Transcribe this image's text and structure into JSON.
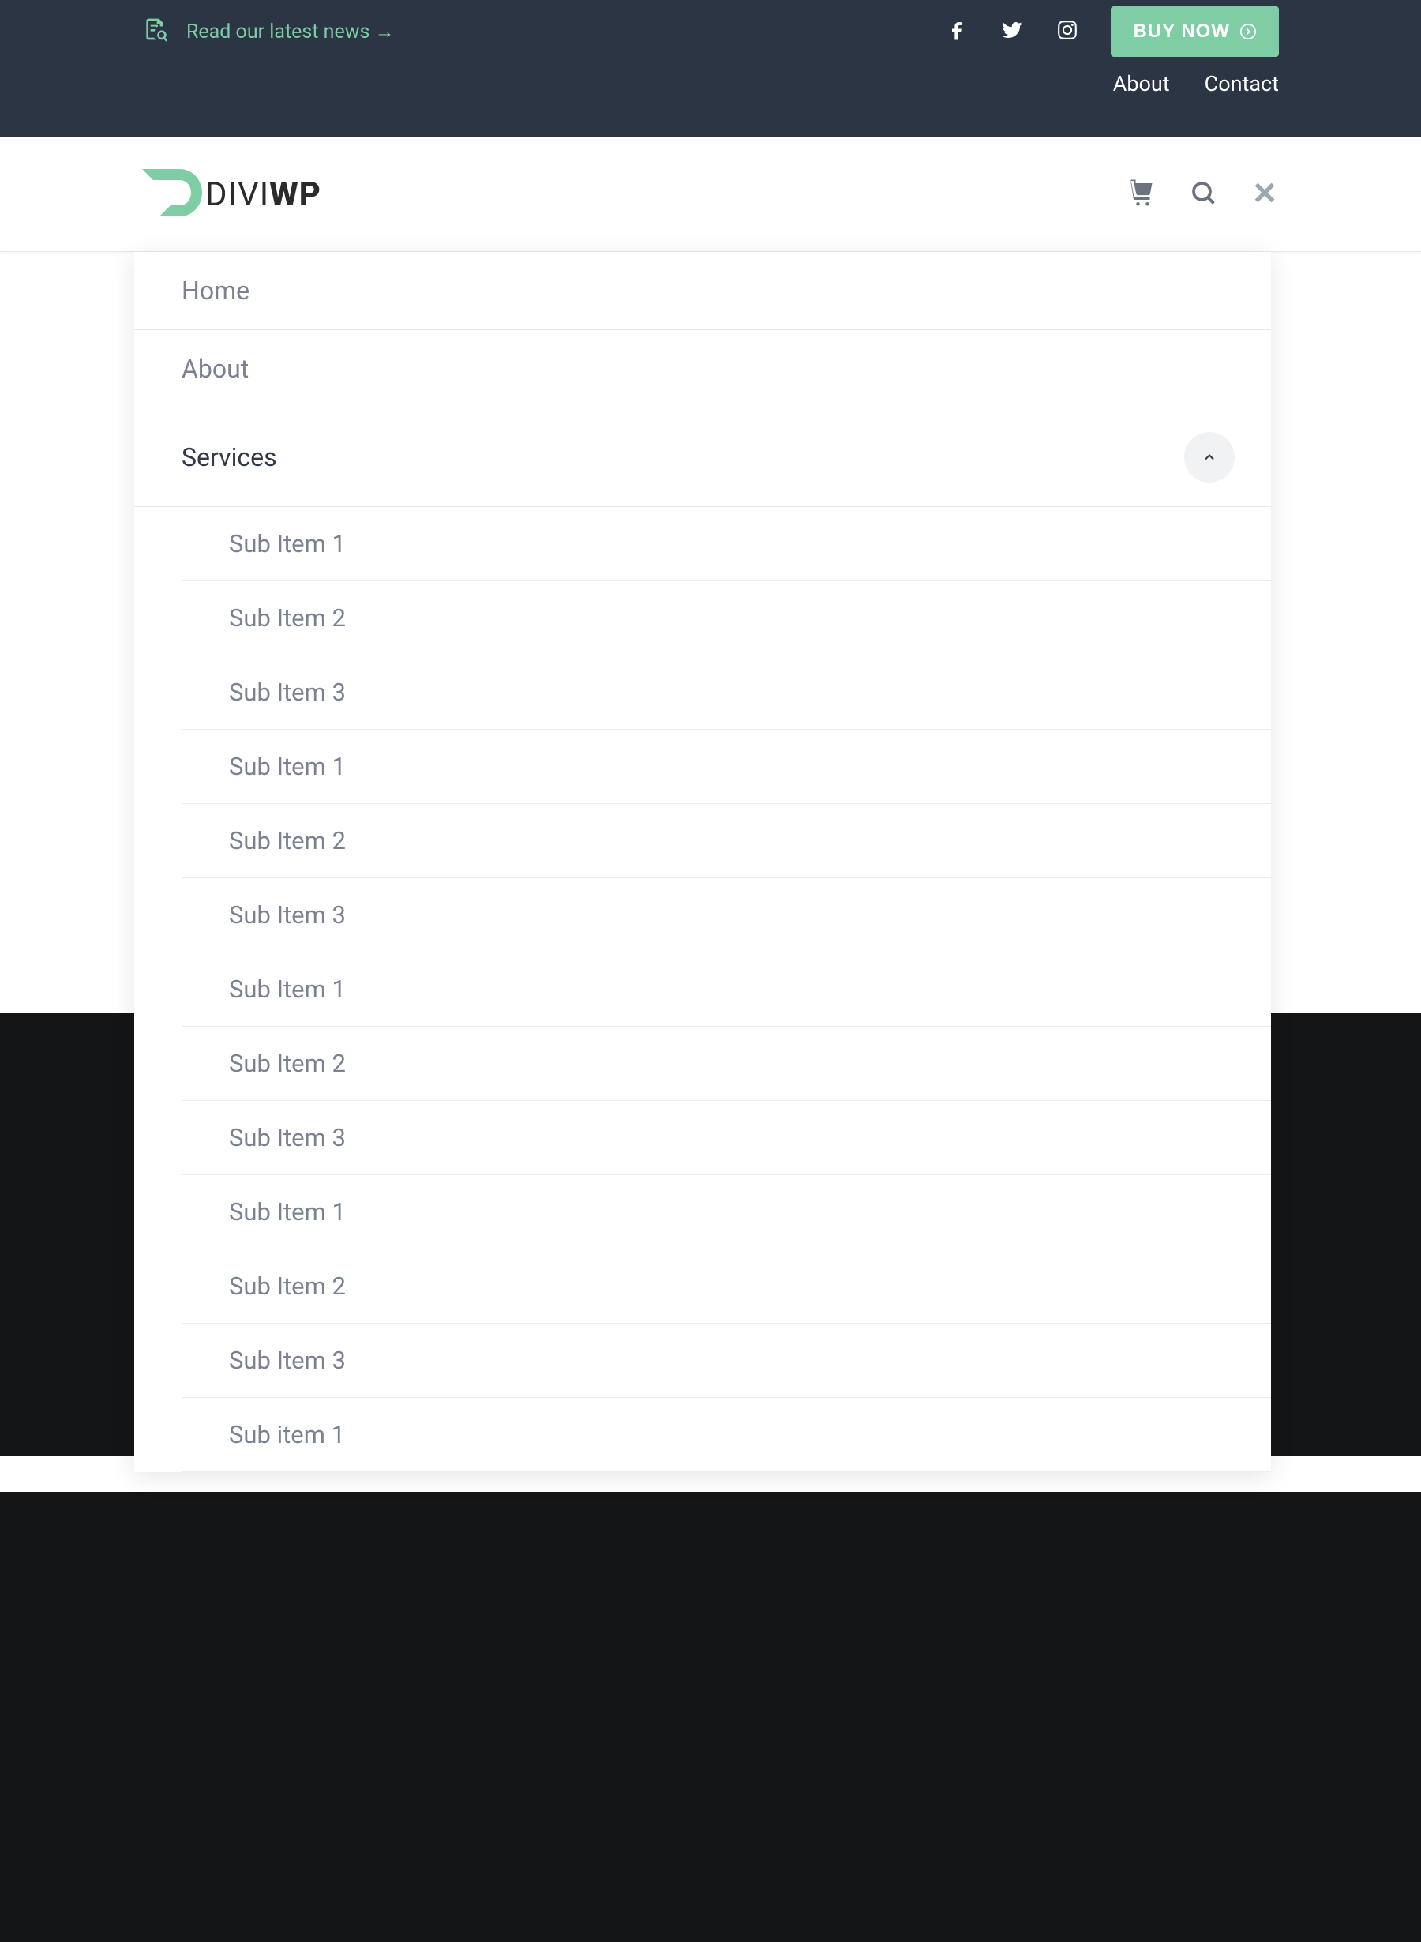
{
  "topbar": {
    "news_text": "Read our latest news →",
    "buy_label": "BUY NOW"
  },
  "secondary_nav": {
    "about": "About",
    "contact": "Contact"
  },
  "logo": {
    "text_light": "DIVI",
    "text_bold": "WP"
  },
  "menu": {
    "home": "Home",
    "about": "About",
    "services": "Services",
    "subs": [
      "Sub Item 1",
      "Sub Item 2",
      "Sub Item 3",
      "Sub Item 1",
      "Sub Item 2",
      "Sub Item 3",
      "Sub Item 1",
      "Sub Item 2",
      "Sub Item 3",
      "Sub Item 1",
      "Sub Item 2",
      "Sub Item 3",
      "Sub item 1"
    ]
  },
  "colors": {
    "accent": "#7fcda5",
    "darkbar": "#2b3543",
    "dark_section": "#141516"
  }
}
